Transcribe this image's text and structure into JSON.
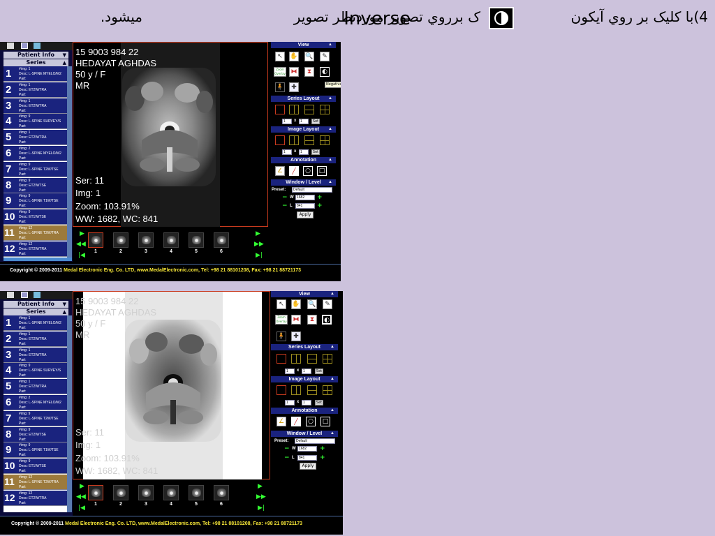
{
  "instruction": {
    "part1": "4)با کليک بر روي آيکون",
    "part2": "ک برروي تصوير موردنظر تصوير",
    "word": "Inverse",
    "part3": "ميشود."
  },
  "viewer": {
    "patient_id": "15 9003 984 22",
    "patient_name": "HEDAYAT AGHDAS",
    "age_sex": "50 y / F",
    "modality": "MR",
    "series": "Ser: 11",
    "image": "Img: 1",
    "zoom": "Zoom: 103.91%",
    "window": "WW: 1682, WC: 841"
  },
  "sidebar": {
    "patient_info_label": "Patient Info",
    "series_label": "Series",
    "items": [
      {
        "num": "1",
        "img": "#img: 1",
        "desc": "Desc: L-SPINE MYELO/M2",
        "part": "Part:"
      },
      {
        "num": "2",
        "img": "#img: 1",
        "desc": "Desc: ET2W/TRA",
        "part": "Part:"
      },
      {
        "num": "3",
        "img": "#img: 1",
        "desc": "Desc: ET2W/TRA",
        "part": "Part:"
      },
      {
        "num": "4",
        "img": "#img: 9",
        "desc": "Desc: L-SPINE SURVEY/S",
        "part": "Part:"
      },
      {
        "num": "5",
        "img": "#img: 1",
        "desc": "Desc: ET2W/TRA",
        "part": "Part:"
      },
      {
        "num": "6",
        "img": "#img: 2",
        "desc": "Desc: L-SPINE MYELO/M2",
        "part": "Part:"
      },
      {
        "num": "7",
        "img": "#img: 9",
        "desc": "Desc: L-SPINE T2W/TSE",
        "part": "Part:"
      },
      {
        "num": "8",
        "img": "#img: 9",
        "desc": "Desc: ET2W/TSE",
        "part": "Part:"
      },
      {
        "num": "9",
        "img": "#img: 9",
        "desc": "Desc: L-SPINE T1W/TSE",
        "part": "Part:"
      },
      {
        "num": "10",
        "img": "#img: 9",
        "desc": "Desc: ET1W/TSE",
        "part": "Part:"
      },
      {
        "num": "11",
        "img": "#img: 12",
        "desc": "Desc: L-SPINE T2W/TRA",
        "part": "Part:"
      },
      {
        "num": "12",
        "img": "#img: 12",
        "desc": "Desc: ET2W/TRA",
        "part": "Part:"
      }
    ],
    "selected_index": 10
  },
  "thumbnails": {
    "labels": [
      "1",
      "2",
      "3",
      "4",
      "5",
      "6"
    ],
    "selected_index": 0
  },
  "panel": {
    "view_label": "View",
    "zoom_overlay_label": "Zoom Overlay",
    "negative_tooltip": "Negative",
    "series_layout_label": "Series Layout",
    "image_layout_label": "Image Layout",
    "annotation_label": "Annotation",
    "window_level_label": "Window / Level",
    "layout_rows": "1",
    "layout_cols": "1",
    "layout_x": "x",
    "set_label": "Set",
    "preset_label": "Preset:",
    "preset_value": "Default",
    "w_label": "W",
    "l_label": "L",
    "w_value": "1682",
    "l_value": "841",
    "apply_label": "Apply"
  },
  "footer": {
    "copyright_prefix": "Copyright © 2009-2011 ",
    "copyright_company": "Medal Electronic Eng. Co. LTD, www.MedalElectronic.com, Tel: +98 21 88101208, Fax: +98 21 88721173"
  },
  "colors": {
    "background": "#ccc2dc",
    "series_bg": "#1a237e",
    "series_selected": "#9c7a3c",
    "viewer_border": "#c83a1e",
    "green_accent": "#33ff33",
    "footer_company": "#f8e838"
  }
}
